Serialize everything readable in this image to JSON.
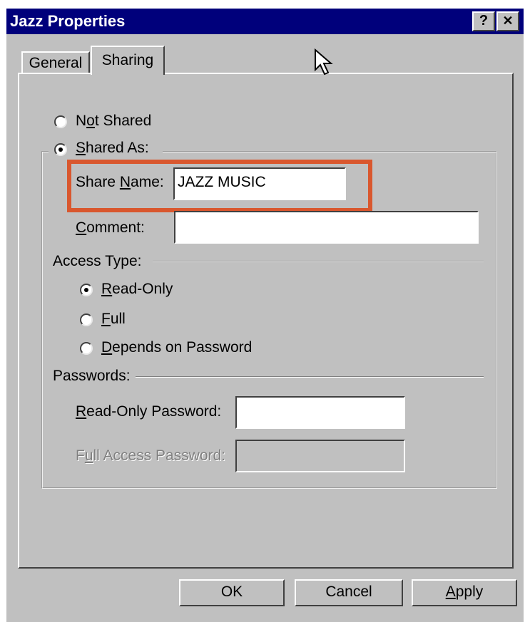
{
  "window": {
    "title": "Jazz Properties",
    "help_button": "?",
    "close_button": "✕"
  },
  "tabs": [
    {
      "label": "General",
      "active": false
    },
    {
      "label": "Sharing",
      "active": true
    }
  ],
  "sharing": {
    "not_shared": {
      "label": "Not Shared",
      "underline_char": "o",
      "selected": false
    },
    "shared_as": {
      "label": "Shared As:",
      "selected": true
    },
    "share_name": {
      "label": "Share Name:",
      "value": "JAZZ MUSIC"
    },
    "comment": {
      "label": "Comment:",
      "value": ""
    },
    "access_type": {
      "label": "Access Type:",
      "options": [
        {
          "label": "Read-Only",
          "selected": true
        },
        {
          "label": "Full",
          "selected": false
        },
        {
          "label": "Depends on Password",
          "selected": false
        }
      ]
    },
    "passwords": {
      "label": "Passwords:",
      "read_only_password": {
        "label": "Read-Only Password:",
        "value": ""
      },
      "full_access_password": {
        "label": "Full Access Password:",
        "value": "",
        "disabled": true
      }
    }
  },
  "buttons": {
    "ok": "OK",
    "cancel": "Cancel",
    "apply": "Apply"
  },
  "colors": {
    "titlebar": "#00007b",
    "dialog_face": "#c0c0c0",
    "highlight_box": "#d9572e"
  }
}
